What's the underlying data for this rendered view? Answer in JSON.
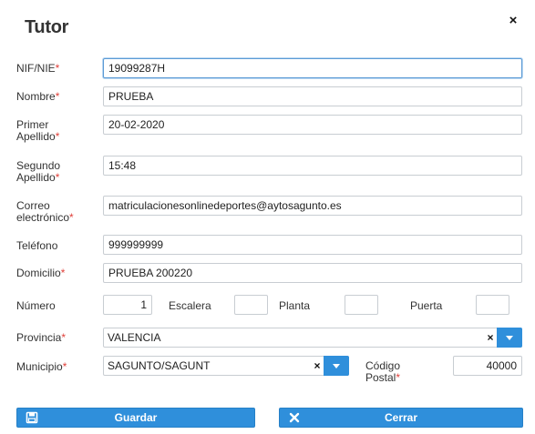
{
  "dialog": {
    "title": "Tutor",
    "close_icon": "×"
  },
  "form": {
    "required_mark": "*",
    "nif": {
      "label": "NIF/NIE",
      "value": "19099287H"
    },
    "nombre": {
      "label": "Nombre",
      "value": "PRUEBA"
    },
    "primer_apellido": {
      "label_line1": "Primer",
      "label_line2": "Apellido",
      "value": "20-02-2020"
    },
    "segundo_apellido": {
      "label_line1": "Segundo",
      "label_line2": "Apellido",
      "value": "15:48"
    },
    "correo": {
      "label_line1": "Correo",
      "label_line2": "electrónico",
      "value": "matriculacionesonlinedeportes@aytosagunto.es"
    },
    "telefono": {
      "label": "Teléfono",
      "value": "999999999"
    },
    "domicilio": {
      "label": "Domicilio",
      "value": "PRUEBA 200220"
    },
    "numero": {
      "label": "Número",
      "value": "1"
    },
    "escalera": {
      "label": "Escalera",
      "value": ""
    },
    "planta": {
      "label": "Planta",
      "value": ""
    },
    "puerta": {
      "label": "Puerta",
      "value": ""
    },
    "provincia": {
      "label": "Provincia",
      "value": "VALENCIA",
      "clear_icon": "×"
    },
    "municipio": {
      "label": "Municipio",
      "value": "SAGUNTO/SAGUNT",
      "clear_icon": "×"
    },
    "codigo_postal": {
      "label_line1": "Código",
      "label_line2": "Postal",
      "value": "40000"
    }
  },
  "buttons": {
    "guardar": {
      "label": "Guardar",
      "icon": "floppy-disk-icon"
    },
    "cerrar": {
      "label": "Cerrar",
      "icon": "close-icon"
    }
  },
  "colors": {
    "accent": "#2f8fdb",
    "required": "#e0403a",
    "focus_border": "#5b9bd5"
  }
}
